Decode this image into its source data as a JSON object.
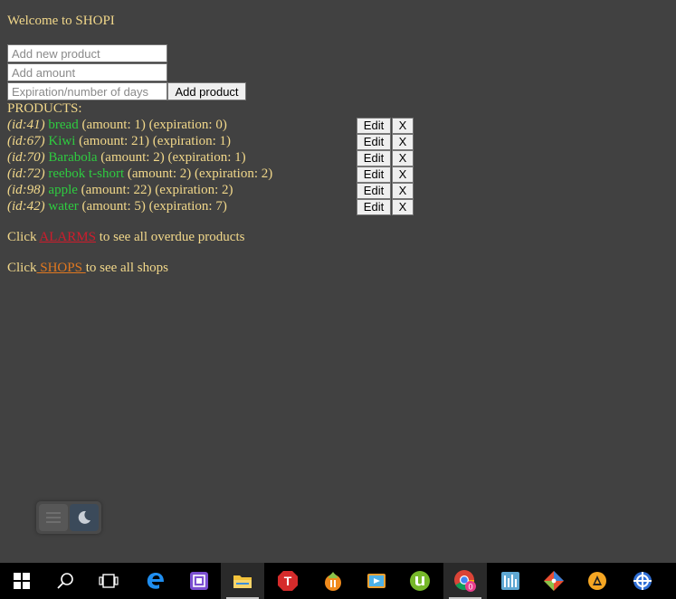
{
  "welcome": "Welcome to SHOPI",
  "form": {
    "product_placeholder": "Add new product",
    "amount_placeholder": "Add amount",
    "expiration_placeholder": "Expiration/number of days",
    "add_label": "Add product"
  },
  "products_heading": "PRODUCTS:",
  "edit_label": "Edit",
  "delete_label": "X",
  "products": [
    {
      "id": "(id:41)",
      "name": "bread",
      "details": "(amount: 1) (expiration: 0)"
    },
    {
      "id": "(id:67)",
      "name": "Kiwi",
      "details": "(amount: 21) (expiration: 1)"
    },
    {
      "id": "(id:70)",
      "name": "Barabola",
      "details": "(amount: 2) (expiration: 1)"
    },
    {
      "id": "(id:72)",
      "name": "reebok t-short",
      "details": "(amount: 2) (expiration: 2)"
    },
    {
      "id": "(id:98)",
      "name": "apple",
      "details": "(amount: 22) (expiration: 2)"
    },
    {
      "id": "(id:42)",
      "name": "water",
      "details": "(amount: 5) (expiration: 7)"
    }
  ],
  "alarms_line": {
    "prefix": "Click ",
    "link": "ALARMS",
    "suffix": " to see all overdue products"
  },
  "shops_line": {
    "prefix": "Click",
    "link": " SHOPS ",
    "suffix": "to see all shops"
  },
  "colors": {
    "background": "#414141",
    "text": "#f2d88a",
    "product_name": "#2ecc40",
    "alarms_link": "#d01c2c",
    "shops_link": "#e07820"
  },
  "theme_toggle": {
    "left_icon": "menu-lines-icon",
    "right_icon": "moon-icon"
  },
  "taskbar": {
    "items": [
      {
        "icon": "windows-start-icon"
      },
      {
        "icon": "search-icon"
      },
      {
        "icon": "task-view-icon"
      },
      {
        "icon": "edge-icon"
      },
      {
        "icon": "app-chip-icon"
      },
      {
        "icon": "file-explorer-icon"
      },
      {
        "icon": "red-t-app-icon"
      },
      {
        "icon": "fl-studio-icon"
      },
      {
        "icon": "media-player-icon"
      },
      {
        "icon": "utorrent-icon"
      },
      {
        "icon": "chrome-icon",
        "badge": "0"
      },
      {
        "icon": "equalizer-app-icon"
      },
      {
        "icon": "git-icon"
      },
      {
        "icon": "aimp-icon"
      },
      {
        "icon": "blue-circle-app-icon"
      }
    ]
  }
}
